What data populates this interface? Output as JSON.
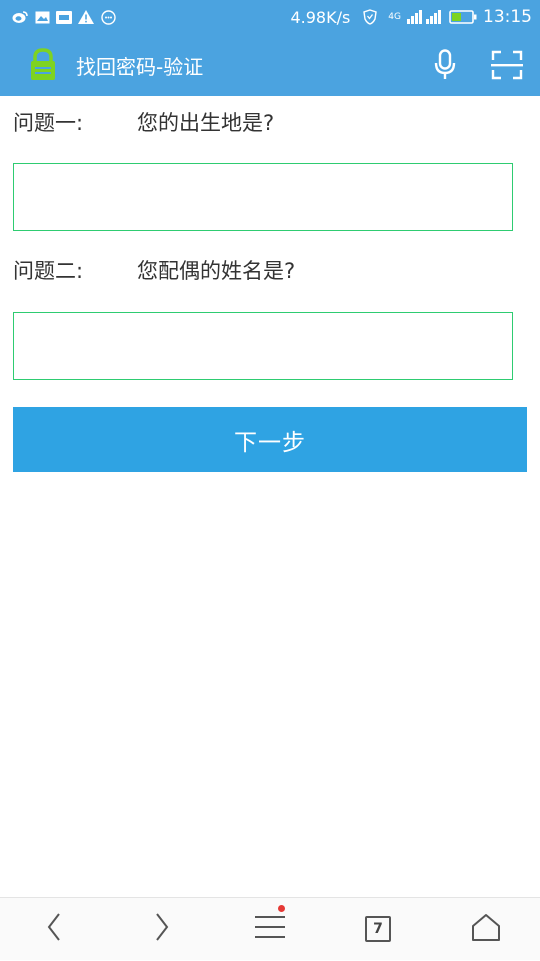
{
  "status_bar": {
    "net_speed": "4.98K/s",
    "network_type": "4G",
    "time": "13:15",
    "icons": [
      "weibo-icon",
      "image-icon",
      "lehe-icon",
      "warning-icon",
      "chat-icon",
      "shield-icon",
      "signal-icon",
      "battery-icon"
    ]
  },
  "header": {
    "title": "找回密码-验证",
    "lock_icon": "lock-icon",
    "actions": [
      "microphone-icon",
      "scan-icon"
    ]
  },
  "form": {
    "question1_label": "问题一:",
    "question1_text": "您的出生地是?",
    "answer1_value": "",
    "question2_label": "问题二:",
    "question2_text": "您配偶的姓名是?",
    "answer2_value": "",
    "next_label": "下一步"
  },
  "bottom_nav": {
    "items": [
      "back-icon",
      "forward-icon",
      "menu-icon",
      "tabs-icon",
      "home-icon"
    ],
    "tab_count": "7",
    "menu_has_badge": true
  },
  "colors": {
    "header_bg": "#4ba3e0",
    "button_bg": "#2fa3e3",
    "input_border": "#2ecc71",
    "lock_color": "#7ed321",
    "badge_color": "#e53935"
  }
}
